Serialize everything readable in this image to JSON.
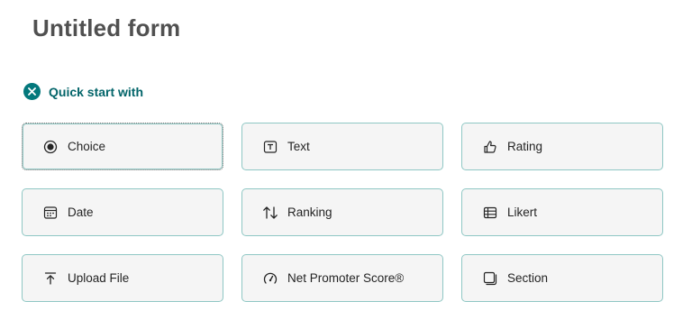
{
  "form": {
    "title": "Untitled form"
  },
  "quick_start": {
    "label": "Quick start with"
  },
  "question_types": [
    {
      "label": "Choice",
      "icon": "radio-button-icon"
    },
    {
      "label": "Text",
      "icon": "text-box-icon"
    },
    {
      "label": "Rating",
      "icon": "thumbs-up-icon"
    },
    {
      "label": "Date",
      "icon": "calendar-icon"
    },
    {
      "label": "Ranking",
      "icon": "sort-arrows-icon"
    },
    {
      "label": "Likert",
      "icon": "table-grid-icon"
    },
    {
      "label": "Upload File",
      "icon": "upload-icon"
    },
    {
      "label": "Net Promoter Score®",
      "icon": "gauge-icon"
    },
    {
      "label": "Section",
      "icon": "section-icon"
    }
  ],
  "colors": {
    "accent": "#03787c",
    "card_border": "#8fc7c4",
    "card_bg": "#f5f5f5"
  }
}
